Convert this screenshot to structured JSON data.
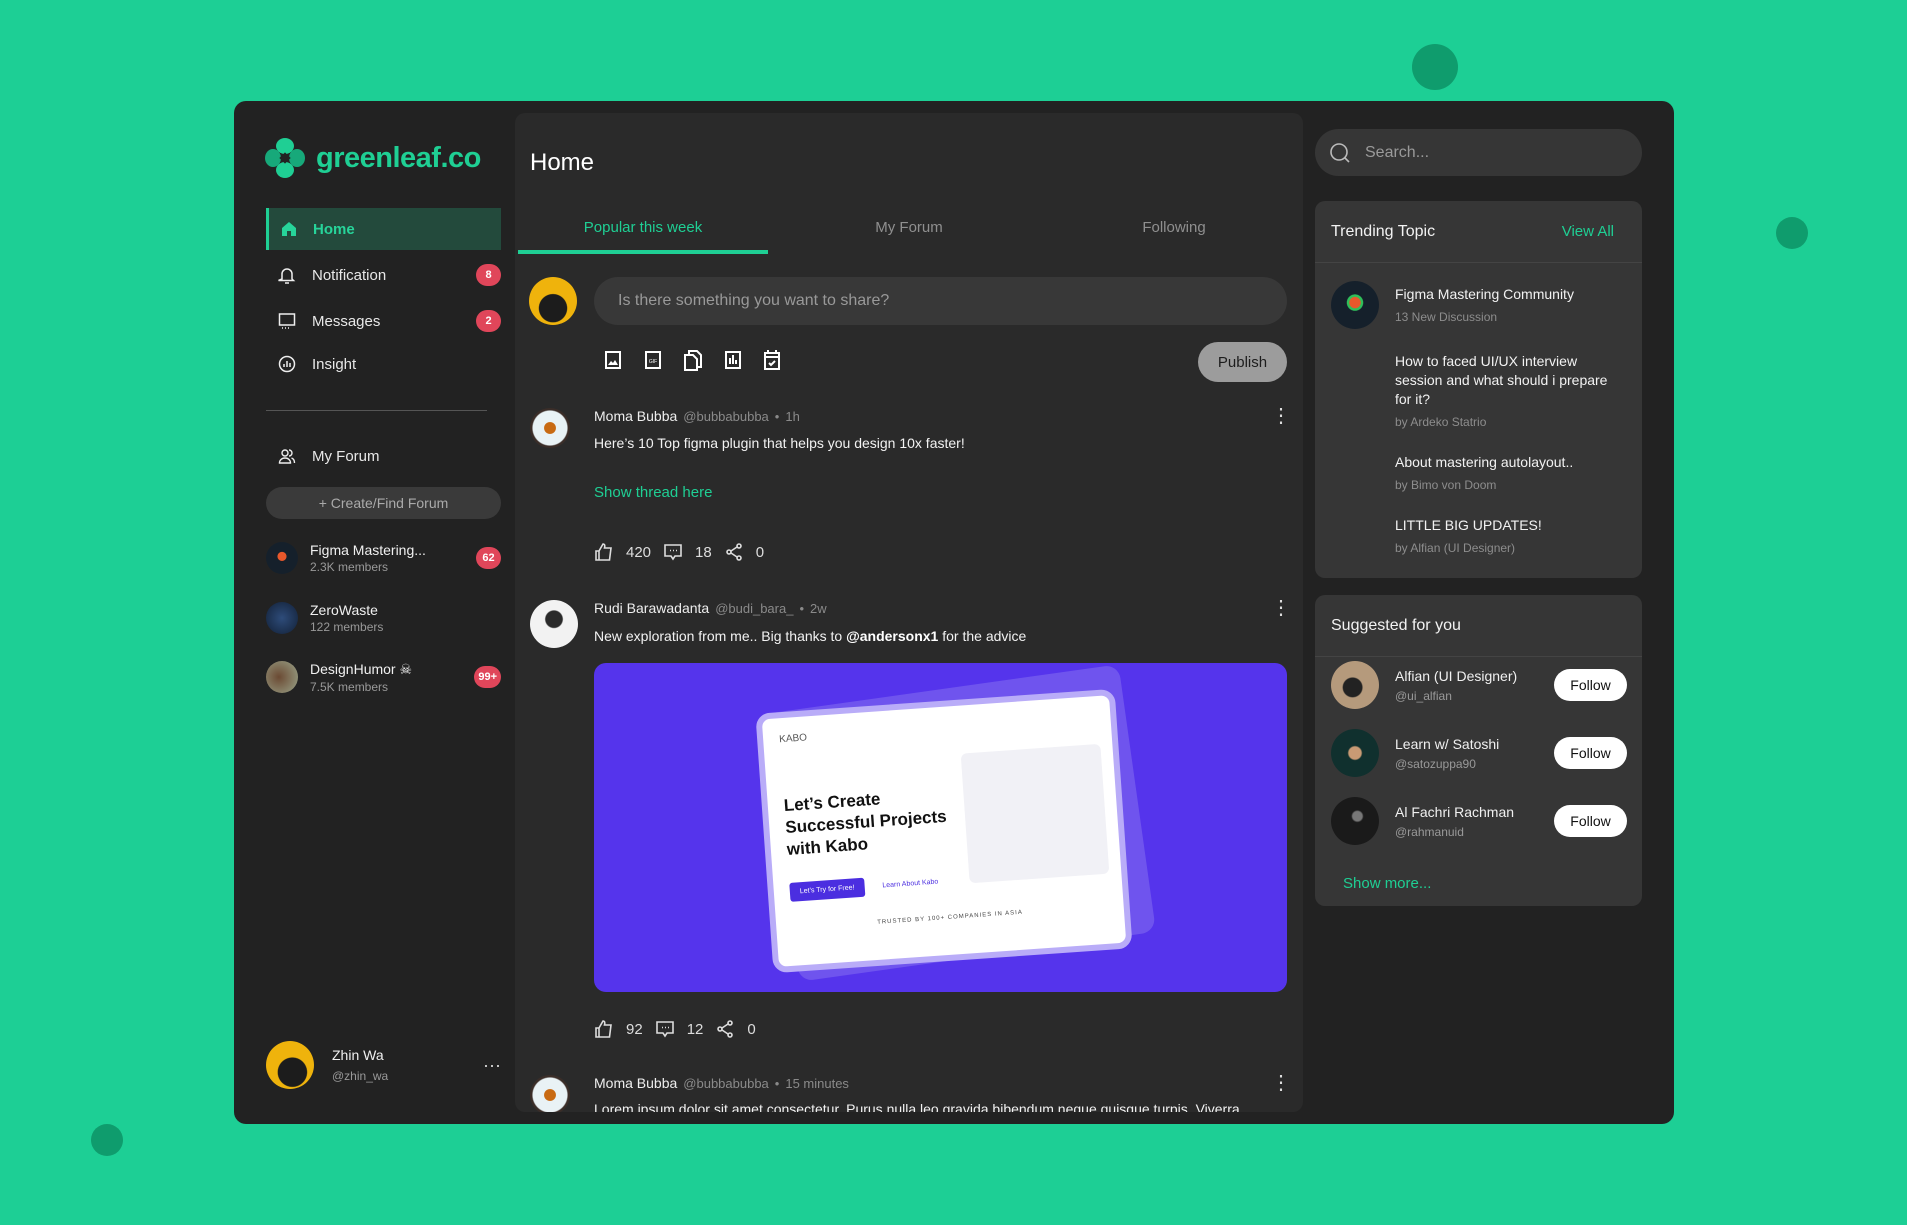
{
  "brand": {
    "name": "greenleaf.co",
    "accent": "#1fcf94",
    "background": "#1dcf95"
  },
  "sidebar": {
    "items": [
      {
        "label": "Home",
        "icon": "home-icon",
        "active": true
      },
      {
        "label": "Notification",
        "icon": "bell-icon",
        "badge": "8"
      },
      {
        "label": "Messages",
        "icon": "message-icon",
        "badge": "2"
      },
      {
        "label": "Insight",
        "icon": "chart-icon"
      }
    ],
    "my_forum": "My Forum",
    "create_forum": "+ Create/Find Forum",
    "forums": [
      {
        "name": "Figma Mastering...",
        "members": "2.3K members",
        "badge": "62"
      },
      {
        "name": "ZeroWaste",
        "members": "122 members"
      },
      {
        "name": "DesignHumor ☠",
        "members": "7.5K members",
        "badge": "99+"
      }
    ],
    "user": {
      "name": "Zhin Wa",
      "handle": "@zhin_wa"
    }
  },
  "main": {
    "title": "Home",
    "tabs": [
      {
        "label": "Popular this week",
        "active": true
      },
      {
        "label": "My Forum"
      },
      {
        "label": "Following"
      }
    ],
    "composer": {
      "placeholder": "Is there something you want to share?",
      "publish": "Publish",
      "tools": [
        "image-icon",
        "gif-icon",
        "file-icon",
        "poll-icon",
        "schedule-icon"
      ]
    },
    "posts": [
      {
        "author": "Moma Bubba",
        "handle": "@bubbabubba",
        "time": "1h",
        "text": "Here’s 10 Top figma plugin that helps you design 10x faster!",
        "link": "Show thread here",
        "likes": "420",
        "comments": "18",
        "shares": "0"
      },
      {
        "author": "Rudi Barawadanta",
        "handle": "@budi_bara_",
        "time": "2w",
        "text_before": "New exploration from me.. Big thanks to ",
        "mention": "@andersonx1",
        "text_after": " for the advice",
        "likes": "92",
        "comments": "12",
        "shares": "0",
        "image": {
          "brand": "KABO",
          "headline": "Let’s Create Successful Projects with Kabo",
          "cta": "Let’s Try for Free!",
          "secondary": "Learn About Kabo",
          "trusted": "TRUSTED BY 100+ COMPANIES IN ASIA"
        }
      },
      {
        "author": "Moma Bubba",
        "handle": "@bubbabubba",
        "time": "15 minutes",
        "text": "Lorem ipsum dolor sit amet consectetur. Purus nulla leo gravida bibendum neque quisque turpis. Viverra"
      }
    ]
  },
  "right": {
    "search_placeholder": "Search...",
    "trending": {
      "title": "Trending Topic",
      "view_all": "View All",
      "items": [
        {
          "title": "Figma Mastering Community",
          "sub": "13 New Discussion"
        },
        {
          "title": "How to faced UI/UX interview session and what should i prepare for it?",
          "sub": "by Ardeko Statrio"
        },
        {
          "title": "About mastering autolayout..",
          "sub": "by Bimo von Doom"
        },
        {
          "title": "LITTLE BIG UPDATES!",
          "sub": "by Alfian (UI Designer)"
        }
      ]
    },
    "suggested": {
      "title": "Suggested for you",
      "follow": "Follow",
      "show_more": "Show more...",
      "users": [
        {
          "name": "Alfian (UI Designer)",
          "handle": "@ui_alfian"
        },
        {
          "name": "Learn w/ Satoshi",
          "handle": "@satozuppa90"
        },
        {
          "name": "Al Fachri Rachman",
          "handle": "@rahmanuid"
        }
      ]
    }
  }
}
